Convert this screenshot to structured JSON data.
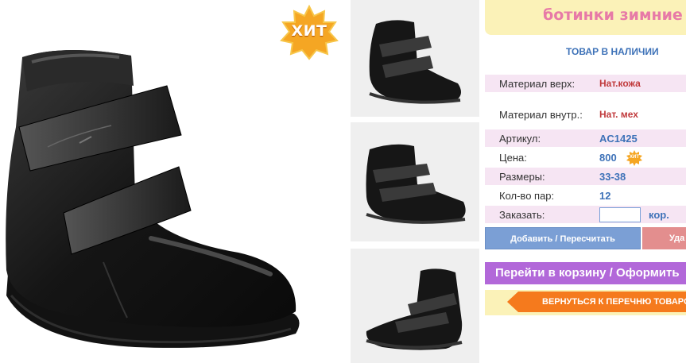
{
  "product": {
    "title": "ботинки зимние",
    "hit_badge": "ХИТ",
    "stock_status": "ТОВАР В НАЛИЧИИ"
  },
  "specs": [
    {
      "label": "Материал верх:",
      "value": "Нат.кожа"
    },
    {
      "label": "Материал внутр.:",
      "value": "Нат. мех"
    },
    {
      "label": "Артикул:",
      "value": "AC1425"
    },
    {
      "label": "Цена:",
      "value": "800"
    },
    {
      "label": "Размеры:",
      "value": "33-38"
    },
    {
      "label": "Кол-во пар:",
      "value": "12"
    }
  ],
  "price_hit_badge": "ХИТ",
  "order": {
    "label": "Заказать:",
    "quantity_value": "",
    "unit": "кор."
  },
  "buttons": {
    "add_recalc": "Добавить / Пересчитать",
    "delete": "Уда",
    "cart": "Перейти в корзину / Оформить",
    "back": "ВЕРНУТЬСЯ К ПЕРЕЧНЮ ТОВАРОВ"
  },
  "images": {
    "main": "black-leather-velcro-boot-photo",
    "thumbnails": [
      "boot-thumbnail-front",
      "boot-thumbnail-side",
      "boot-thumbnail-back"
    ]
  },
  "colors": {
    "title_bar": "#fbf2b8",
    "title_text": "#e77aa7",
    "accent_blue": "#3e72b8",
    "value_red": "#c0393b",
    "row_tint": "#f6e5f3",
    "cart_button": "#b268d9",
    "back_button": "#f57a1d"
  }
}
